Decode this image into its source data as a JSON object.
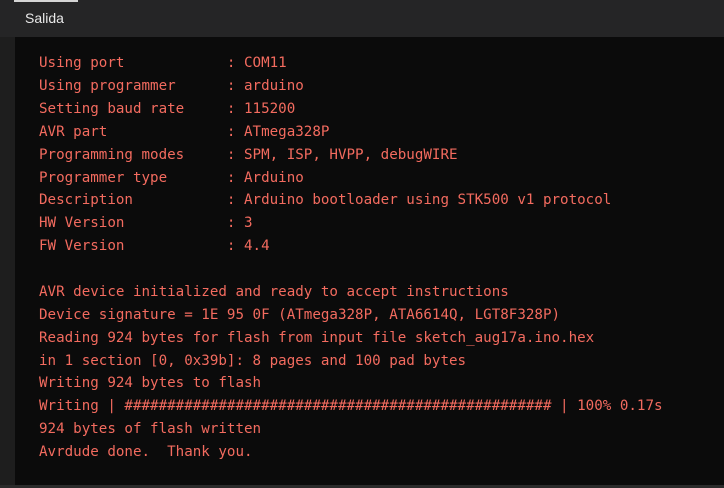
{
  "panel": {
    "tab_label": "Salida"
  },
  "output": {
    "lines": [
      "Using port            : COM11",
      "Using programmer      : arduino",
      "Setting baud rate     : 115200",
      "AVR part              : ATmega328P",
      "Programming modes     : SPM, ISP, HVPP, debugWIRE",
      "Programmer type       : Arduino",
      "Description           : Arduino bootloader using STK500 v1 protocol",
      "HW Version            : 3",
      "FW Version            : 4.4",
      "",
      "AVR device initialized and ready to accept instructions",
      "Device signature = 1E 95 0F (ATmega328P, ATA6614Q, LGT8F328P)",
      "Reading 924 bytes for flash from input file sketch_aug17a.ino.hex",
      "in 1 section [0, 0x39b]: 8 pages and 100 pad bytes",
      "Writing 924 bytes to flash",
      "Writing | ################################################## | 100% 0.17s",
      "924 bytes of flash written",
      "Avrdude done.  Thank you."
    ]
  },
  "colors": {
    "output_text": "#f36b5f",
    "output_background": "#0b0b0b",
    "panel_background": "#1f1f1f"
  }
}
